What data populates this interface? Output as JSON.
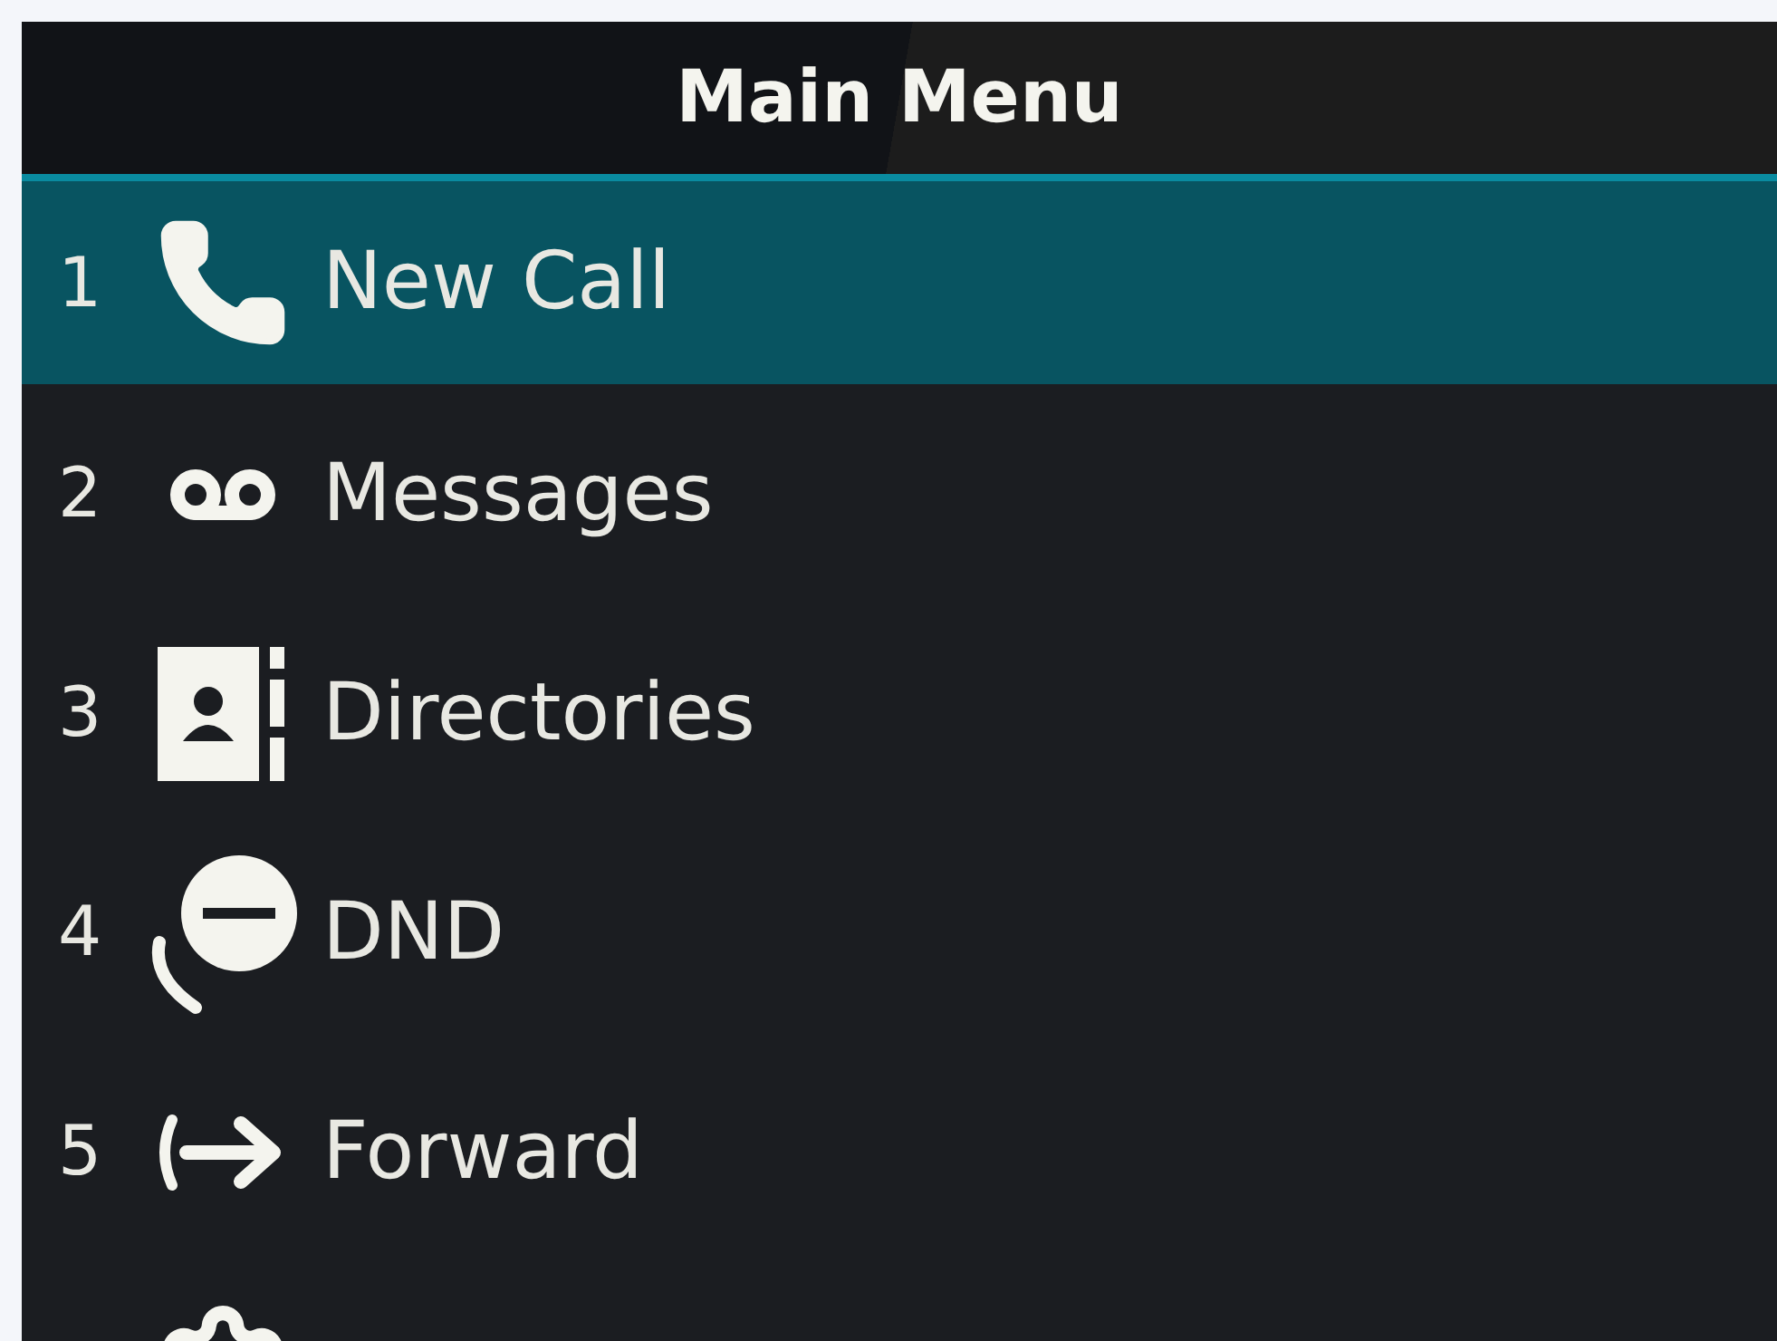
{
  "header": {
    "title": "Main Menu"
  },
  "menu": [
    {
      "number": "1",
      "kind": "phone",
      "label": "New Call",
      "selected": true
    },
    {
      "number": "2",
      "kind": "voicemail",
      "label": "Messages",
      "selected": false
    },
    {
      "number": "3",
      "kind": "directory",
      "label": "Directories",
      "selected": false
    },
    {
      "number": "4",
      "kind": "dnd",
      "label": "DND",
      "selected": false
    },
    {
      "number": "5",
      "kind": "forward",
      "label": "Forward",
      "selected": false
    },
    {
      "kind": "gear",
      "selected": false
    }
  ]
}
